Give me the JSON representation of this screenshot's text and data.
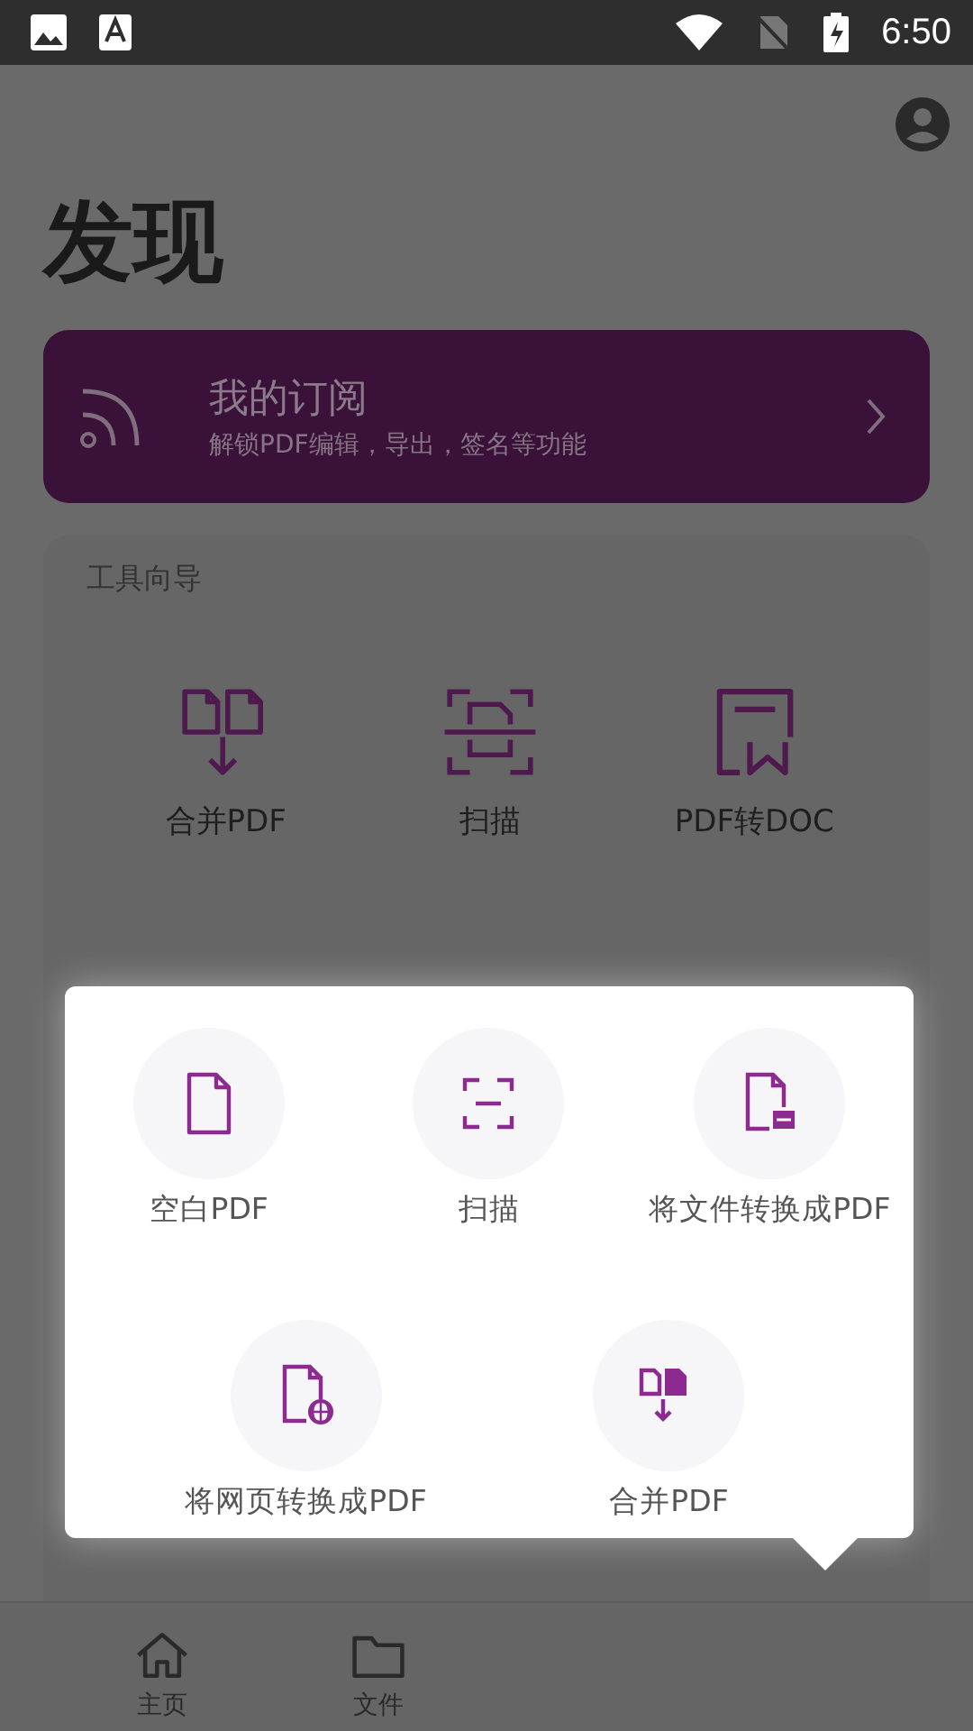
{
  "status_bar": {
    "time": "6:50"
  },
  "page": {
    "title": "发现"
  },
  "subscription": {
    "title": "我的订阅",
    "subtitle": "解锁PDF编辑，导出，签名等功能"
  },
  "tools": {
    "label": "工具向导",
    "items": [
      {
        "kind": "merge",
        "label": "合并PDF"
      },
      {
        "kind": "scan",
        "label": "扫描"
      },
      {
        "kind": "convert",
        "label": "PDF转DOC"
      }
    ]
  },
  "popup": {
    "items": [
      {
        "kind": "blank",
        "label": "空白PDF"
      },
      {
        "kind": "scan",
        "label": "扫描"
      },
      {
        "kind": "file",
        "label": "将文件转换成PDF"
      },
      {
        "kind": "web",
        "label": "将网页转换成PDF"
      },
      {
        "kind": "merge",
        "label": "合并PDF"
      }
    ]
  },
  "bottom_nav": {
    "items": [
      {
        "kind": "home",
        "label": "主页"
      },
      {
        "kind": "folder",
        "label": "文件"
      }
    ]
  }
}
